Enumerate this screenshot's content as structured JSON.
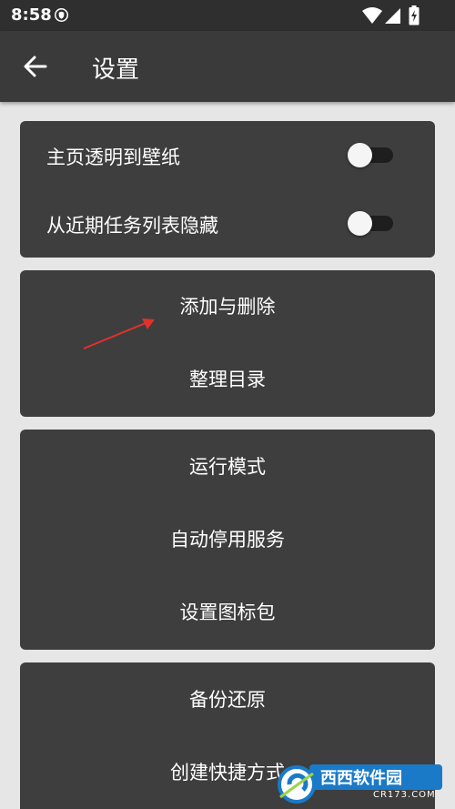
{
  "status_bar": {
    "time": "8:58"
  },
  "app_bar": {
    "title": "设置"
  },
  "card1": {
    "items": [
      {
        "label": "主页透明到壁纸",
        "enabled": false
      },
      {
        "label": "从近期任务列表隐藏",
        "enabled": false
      }
    ]
  },
  "card2": {
    "items": [
      {
        "label": "添加与删除"
      },
      {
        "label": "整理目录"
      }
    ]
  },
  "card3": {
    "items": [
      {
        "label": "运行模式"
      },
      {
        "label": "自动停用服务"
      },
      {
        "label": "设置图标包"
      }
    ]
  },
  "card4": {
    "items": [
      {
        "label": "备份还原"
      },
      {
        "label": "创建快捷方式"
      }
    ]
  },
  "watermark": {
    "text": "西西软件园",
    "sub": "CR173.COM"
  },
  "colors": {
    "background": "#e6e6e6",
    "card": "#3e3e3e",
    "app_bar": "#3a3a3a",
    "status_bar": "#2f2f2f",
    "annotation_arrow": "#e0322a"
  }
}
